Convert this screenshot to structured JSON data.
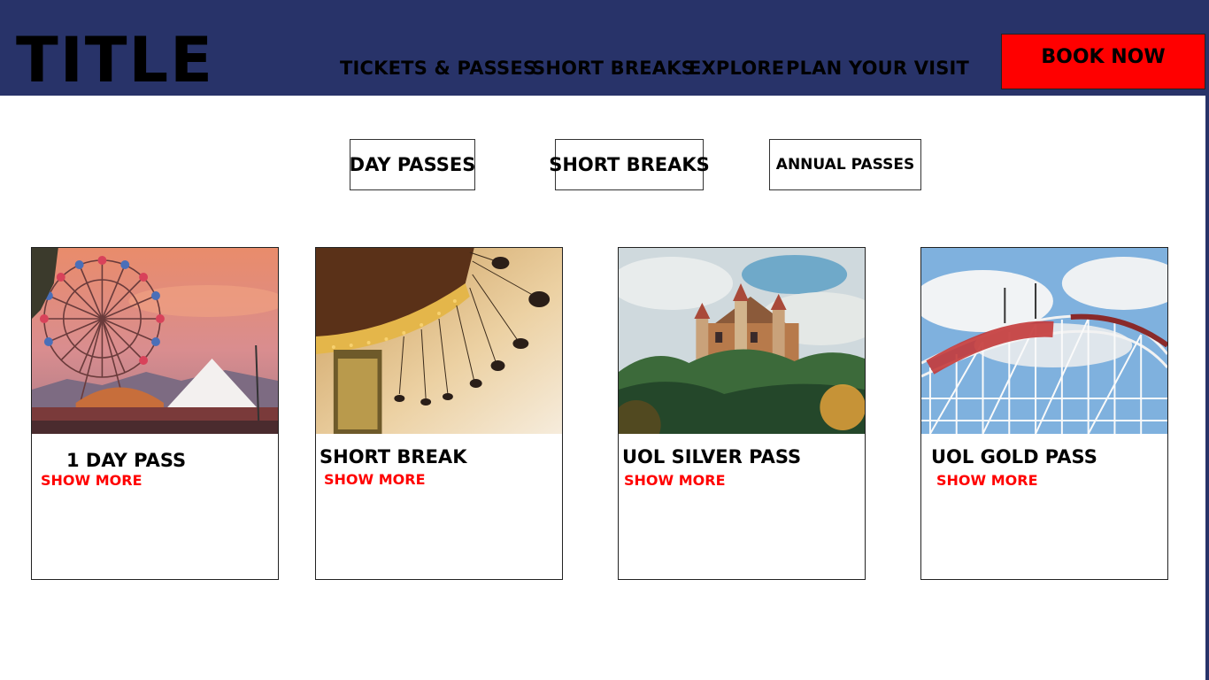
{
  "header": {
    "logo": "TITLE",
    "nav": [
      "TICKETS & PASSES",
      "SHORT BREAKS",
      "EXPLORE",
      "PLAN YOUR VISIT"
    ],
    "cta": "BOOK NOW"
  },
  "filters": [
    "DAY PASSES",
    "SHORT BREAKS",
    "ANNUAL PASSES"
  ],
  "cards": [
    {
      "title": "1 DAY PASS",
      "link": "SHOW MORE",
      "image": "ferris-wheel-sunset"
    },
    {
      "title": "SHORT BREAK",
      "link": "SHOW MORE",
      "image": "swing-carousel"
    },
    {
      "title": "UOL SILVER PASS",
      "link": "SHOW MORE",
      "image": "castle-on-hill"
    },
    {
      "title": "UOL GOLD PASS",
      "link": "SHOW MORE",
      "image": "cyclone-roller-coaster"
    }
  ],
  "colors": {
    "header_bg": "#283369",
    "cta_bg": "#ff0000",
    "link_red": "#ff0000"
  }
}
